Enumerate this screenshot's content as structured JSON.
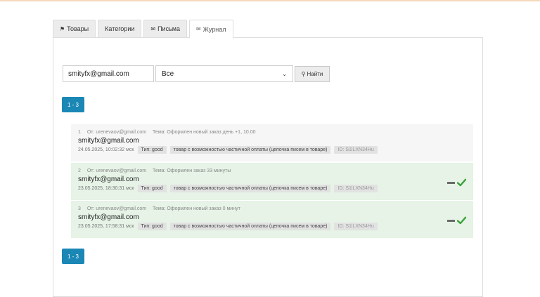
{
  "tabs": [
    {
      "label": "Товары",
      "icon": "tag-icon",
      "active": false
    },
    {
      "label": "Категории",
      "icon": "",
      "active": false
    },
    {
      "label": "Письма",
      "icon": "envelope-icon",
      "active": false
    },
    {
      "label": "Журнал",
      "icon": "envelope-icon",
      "active": true
    }
  ],
  "search": {
    "email_value": "smityfx@gmail.com",
    "select_value": "Все",
    "button_label": "Найти"
  },
  "pagination": {
    "label": "1 - 3"
  },
  "entries": [
    {
      "num": "1",
      "from": "От: urenevaov@gmail.com",
      "subject": "Тема: Оформлен новый заказ день +1, 10.00",
      "email": "smityfx@gmail.com",
      "date": "24.05.2025, 10:02:32 мск",
      "type": "Тип: good",
      "desc": "товар с возможностью частичной оплаты (цепочка писем в товаре)",
      "id": "ID: S1lLXN34Hu",
      "status": "pending"
    },
    {
      "num": "2",
      "from": "От: urenevaov@gmail.com",
      "subject": "Тема: Оформлен заказ 33 минуты",
      "email": "smityfx@gmail.com",
      "date": "23.05.2025, 18:30:31 мск",
      "type": "Тип: good",
      "desc": "товар с возможностью частичной оплаты (цепочка писем в товаре)",
      "id": "ID: S1lLXN34Hu",
      "status": "sent"
    },
    {
      "num": "3",
      "from": "От: urenevaov@gmail.com",
      "subject": "Тема: Оформлен новый заказ 0 минут",
      "email": "smityfx@gmail.com",
      "date": "23.05.2025, 17:58:31 мск",
      "type": "Тип: good",
      "desc": "товар с возможностью частичной оплаты (цепочка писем в товаре)",
      "id": "ID: S1lLXN34Hu",
      "status": "sent"
    }
  ],
  "colors": {
    "accent": "#1a87b5",
    "success_bg": "#e6f3e6",
    "check": "#3aa13a"
  }
}
